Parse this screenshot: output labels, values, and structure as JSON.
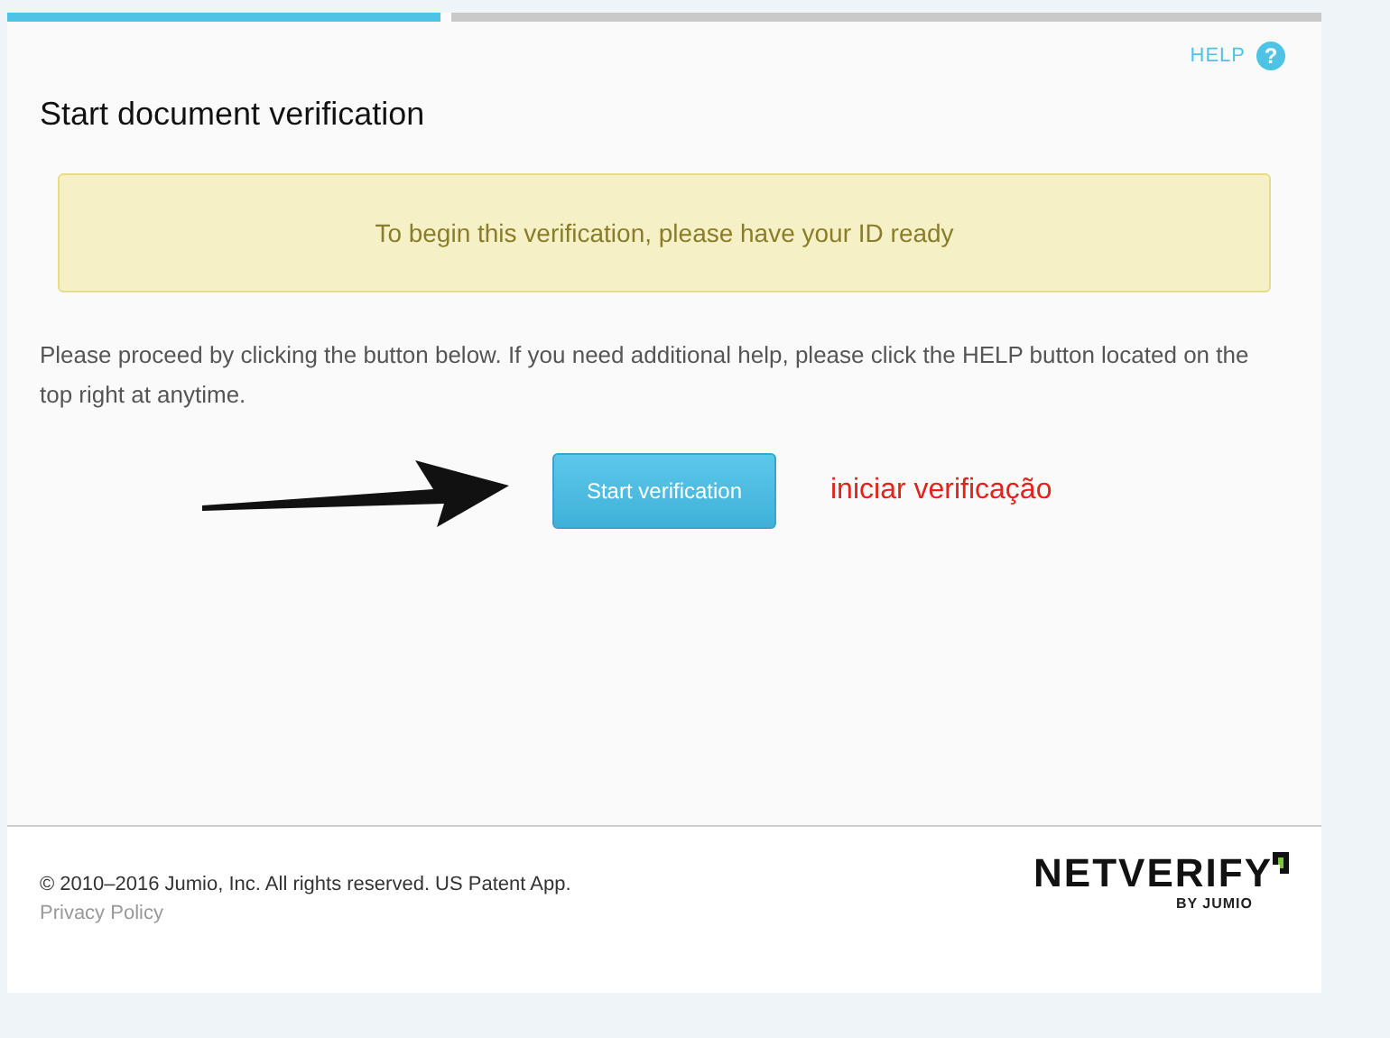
{
  "progress": {
    "steps": [
      {
        "done": true
      },
      {
        "done": false
      }
    ]
  },
  "help": {
    "label": "HELP",
    "icon": "?"
  },
  "title": "Start document verification",
  "notice": "To begin this verification, please have your ID ready",
  "instructions": "Please proceed by clicking the button below. If you need additional help, please click the HELP button located on the top right at anytime.",
  "start_button": "Start verification",
  "annotation": "iniciar verificação",
  "footer": {
    "copyright": "© 2010–2016 Jumio, Inc. All rights reserved. US Patent App.",
    "privacy_link": "Privacy Policy",
    "logo": {
      "name": "NETVERIFY",
      "byline": "BY JUMIO"
    }
  }
}
